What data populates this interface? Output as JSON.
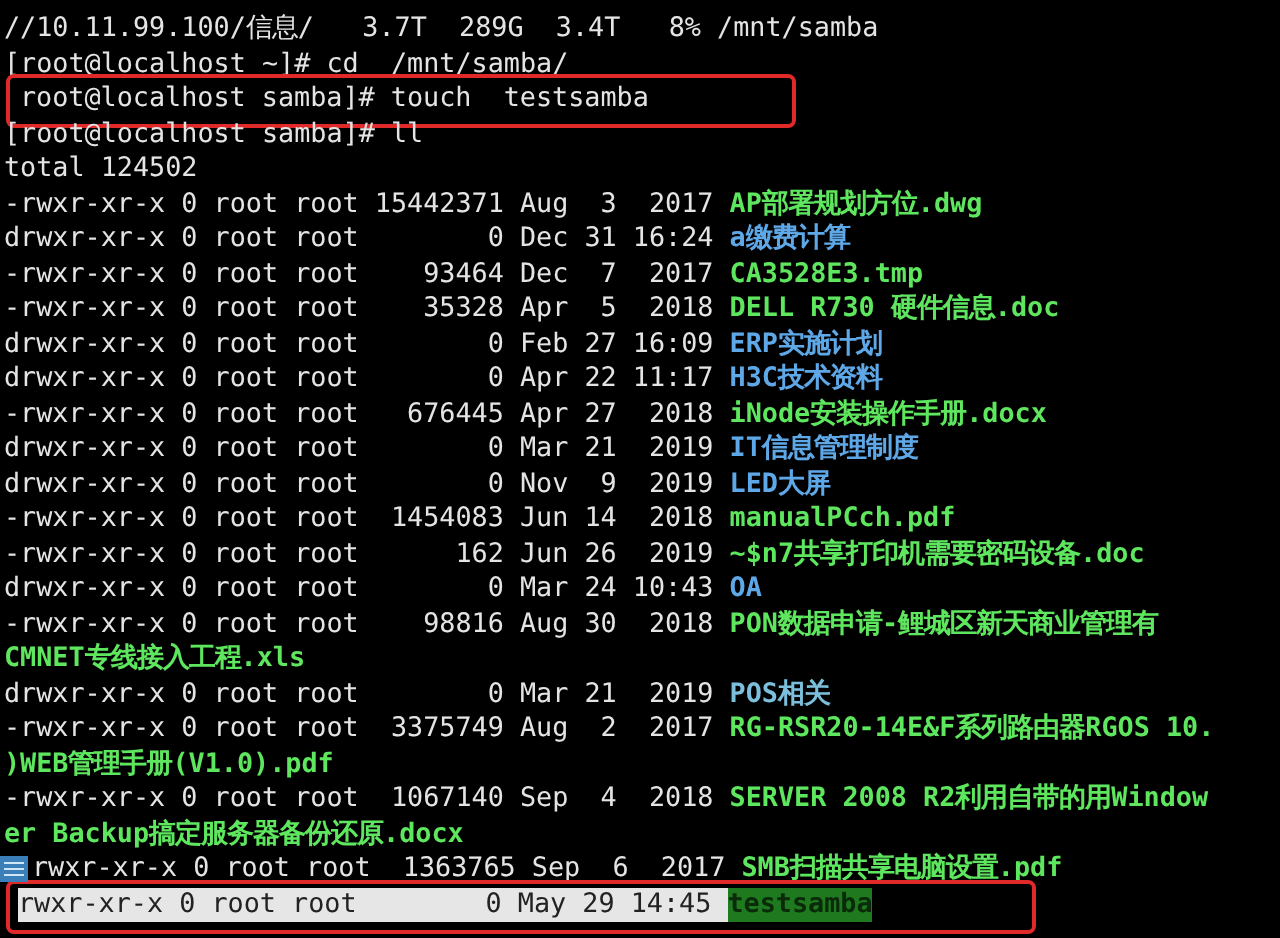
{
  "terminal": {
    "lines": [
      {
        "kind": "output",
        "text": "//10.11.99.100/信息/   3.7T  289G  3.4T   8% /mnt/samba",
        "highlighted": false,
        "boxed": false
      },
      {
        "kind": "prompt",
        "text": "[root@localhost ~]# cd  /mnt/samba/",
        "highlighted": false,
        "boxed": false
      },
      {
        "kind": "prompt",
        "text": "root@localhost samba]# touch  testsamba",
        "highlighted": false,
        "boxed": true
      },
      {
        "kind": "prompt",
        "text": "[root@localhost samba]# ll",
        "highlighted": false,
        "boxed": false
      },
      {
        "kind": "output",
        "text": "total 124502",
        "highlighted": false,
        "boxed": false
      },
      {
        "kind": "entry",
        "color": "#5ee65e",
        "text": "-rwxr-xr-x 0 root root 15442371 Aug  3  2017 ",
        "name": "AP部署规划方位.dwg",
        "highlighted": false,
        "boxed": false
      },
      {
        "kind": "entry",
        "color": "#5fa8e8",
        "text": "drwxr-xr-x 0 root root        0 Dec 31 16:24 ",
        "name": "a缴费计算",
        "highlighted": false,
        "boxed": false
      },
      {
        "kind": "entry",
        "color": "#5ee65e",
        "text": "-rwxr-xr-x 0 root root    93464 Dec  7  2017 ",
        "name": "CA3528E3.tmp",
        "highlighted": false,
        "boxed": false
      },
      {
        "kind": "entry",
        "color": "#5ee65e",
        "text": "-rwxr-xr-x 0 root root    35328 Apr  5  2018 ",
        "name": "DELL R730 硬件信息.doc",
        "highlighted": false,
        "boxed": false
      },
      {
        "kind": "entry",
        "color": "#5fa8e8",
        "text": "drwxr-xr-x 0 root root        0 Feb 27 16:09 ",
        "name": "ERP实施计划",
        "highlighted": false,
        "boxed": false
      },
      {
        "kind": "entry",
        "color": "#5fa8e8",
        "text": "drwxr-xr-x 0 root root        0 Apr 22 11:17 ",
        "name": "H3C技术资料",
        "highlighted": false,
        "boxed": false
      },
      {
        "kind": "entry",
        "color": "#5ee65e",
        "text": "-rwxr-xr-x 0 root root   676445 Apr 27  2018 ",
        "name": "iNode安装操作手册.docx",
        "highlighted": false,
        "boxed": false
      },
      {
        "kind": "entry",
        "color": "#5fa8e8",
        "text": "drwxr-xr-x 0 root root        0 Mar 21  2019 ",
        "name": "IT信息管理制度",
        "highlighted": false,
        "boxed": false
      },
      {
        "kind": "entry",
        "color": "#5fa8e8",
        "text": "drwxr-xr-x 0 root root        0 Nov  9  2019 ",
        "name": "LED大屏",
        "highlighted": false,
        "boxed": false
      },
      {
        "kind": "entry",
        "color": "#5ee65e",
        "text": "-rwxr-xr-x 0 root root  1454083 Jun 14  2018 ",
        "name": "manualPCch.pdf",
        "highlighted": false,
        "boxed": false
      },
      {
        "kind": "entry",
        "color": "#5ee65e",
        "text": "-rwxr-xr-x 0 root root      162 Jun 26  2019 ",
        "name": "~$n7共享打印机需要密码设备.doc",
        "highlighted": false,
        "boxed": false
      },
      {
        "kind": "entry",
        "color": "#5fa8e8",
        "text": "drwxr-xr-x 0 root root        0 Mar 24 10:43 ",
        "name": "OA",
        "highlighted": false,
        "boxed": false
      },
      {
        "kind": "entry",
        "color": "#5ee65e",
        "text": "-rwxr-xr-x 0 root root    98816 Aug 30  2018 ",
        "name": "PON数据申请-鲤城区新天商业管理有",
        "highlighted": false,
        "boxed": false
      },
      {
        "kind": "wrap",
        "color": "#5ee65e",
        "name": "CMNET专线接入工程.xls",
        "highlighted": false,
        "boxed": false
      },
      {
        "kind": "entry",
        "color": "#7cbfdc",
        "text": "drwxr-xr-x 0 root root        0 Mar 21  2019 ",
        "name": "POS相关",
        "highlighted": false,
        "boxed": false
      },
      {
        "kind": "entry",
        "color": "#5ee65e",
        "text": "-rwxr-xr-x 0 root root  3375749 Aug  2  2017 ",
        "name": "RG-RSR20-14E&F系列路由器RGOS 10.",
        "highlighted": false,
        "boxed": false
      },
      {
        "kind": "wrap",
        "color": "#5ee65e",
        "name": ")WEB管理手册(V1.0).pdf",
        "highlighted": false,
        "boxed": false
      },
      {
        "kind": "entry",
        "color": "#5ee65e",
        "text": "-rwxr-xr-x 0 root root  1067140 Sep  4  2018 ",
        "name": "SERVER 2008 R2利用自带的用Window",
        "highlighted": false,
        "boxed": false
      },
      {
        "kind": "wrap",
        "color": "#5ee65e",
        "name": "er Backup搞定服务器备份还原.docx",
        "highlighted": false,
        "boxed": false
      },
      {
        "kind": "clipped",
        "color": "#5ee65e",
        "text": "rwxr-xr-x 0 root root  1363765 Sep  6  2017 ",
        "name": "SMB扫描共享电脑设置.pdf",
        "highlighted": false,
        "boxed": false
      },
      {
        "kind": "clipped",
        "color": "#1f7a1f",
        "text": "rwxr-xr-x 0 root root        0 May 29 14:45 ",
        "name": "testsamba",
        "highlighted": true,
        "boxed": true
      }
    ]
  }
}
